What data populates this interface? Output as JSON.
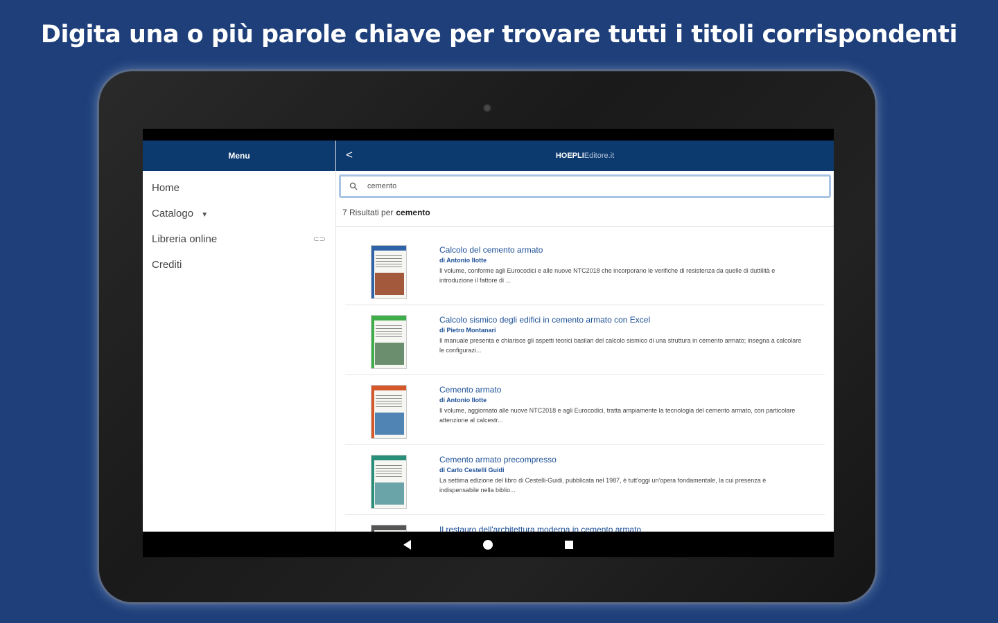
{
  "headline": "Digita una o più parole chiave per trovare tutti i titoli corrispondenti",
  "sidebar": {
    "title": "Menu",
    "items": [
      {
        "label": "Home",
        "has_caret": false
      },
      {
        "label": "Catalogo",
        "has_caret": true
      },
      {
        "label": "Libreria online",
        "has_external": true
      },
      {
        "label": "Crediti"
      }
    ],
    "caret_glyph": "▼",
    "external_glyph": "⊂⊃"
  },
  "header": {
    "back_glyph": "<",
    "brand_main": "HOEPLI",
    "brand_sub": "Editore.it"
  },
  "search": {
    "icon": "search-icon",
    "value": "cemento"
  },
  "results": {
    "count_text": "7 Risultati per",
    "query": "cemento",
    "items": [
      {
        "title": "Calcolo del cemento armato",
        "author": "di Antonio Ilotte",
        "description": "Il volume, conforme agli Eurocodici e alle nuove NTC2018 che incorporano le verifiche di resistenza da quelle di duttilità e introduzione il fattore di ...",
        "cover_color": "#2f63a8",
        "art_color": "#a35a3c"
      },
      {
        "title": "Calcolo sismico degli edifici in cemento armato con Excel",
        "author": "di Pietro Montanari",
        "description": "Il manuale presenta e chiarisce gli aspetti teorici basilari del calcolo sismico di una struttura in cemento armato; insegna a calcolare le configurazi...",
        "cover_color": "#3fae4a",
        "art_color": "#6b8f6e"
      },
      {
        "title": "Cemento armato",
        "author": "di Antonio Ilotte",
        "description": "Il volume, aggiornato alle nuove NTC2018 e agli Eurocodici, tratta ampiamente la tecnologia del cemento armato, con particolare attenzione al calcestr...",
        "cover_color": "#d4582a",
        "art_color": "#4f84b5"
      },
      {
        "title": "Cemento armato precompresso",
        "author": "di Carlo Cestelli Guidi",
        "description": "La settima edizione del libro di Cestelli-Guidi, pubblicata nel 1987, è tutt'oggi un'opera fondamentale, la cui presenza è indispensabile nella biblio...",
        "cover_color": "#2a8f7a",
        "art_color": "#6aa3a8"
      },
      {
        "title": "Il restauro dell'architettura moderna in cemento armato",
        "author": "",
        "description": "",
        "cover_color": "#555555",
        "art_color": "#777777"
      }
    ]
  },
  "system_nav": {
    "back": "back-triangle-icon",
    "home": "home-circle-icon",
    "recent": "recent-square-icon"
  }
}
